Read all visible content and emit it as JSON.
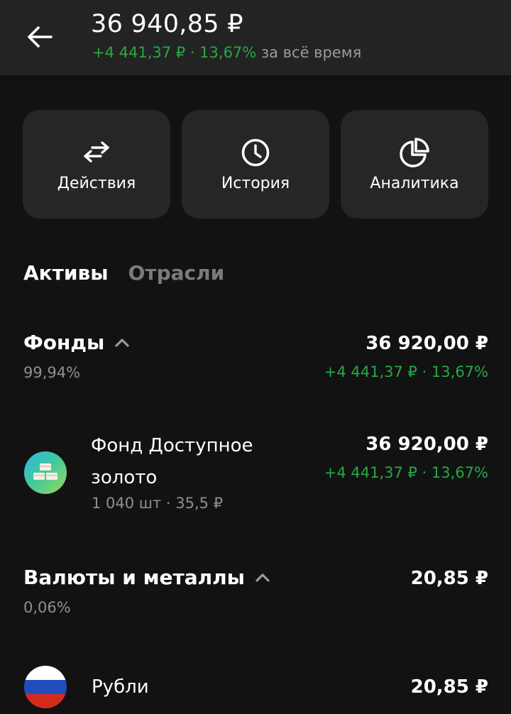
{
  "header": {
    "total": "36 940,85 ₽",
    "change": "+4 441,37 ₽ · 13,67%",
    "period": "за всё время"
  },
  "actions": [
    {
      "label": "Действия",
      "icon": "transfer-arrows-icon"
    },
    {
      "label": "История",
      "icon": "clock-icon"
    },
    {
      "label": "Аналитика",
      "icon": "pie-chart-icon"
    }
  ],
  "tabs": [
    {
      "label": "Активы",
      "active": true
    },
    {
      "label": "Отрасли",
      "active": false
    }
  ],
  "groups": [
    {
      "title": "Фонды",
      "share": "99,94%",
      "amount": "36 920,00 ₽",
      "change": "+4 441,37 ₽ · 13,67%",
      "items": [
        {
          "name": "Фонд Доступное золото",
          "quantity": "1 040 шт · 35,5 ₽",
          "amount": "36 920,00 ₽",
          "change": "+4 441,37 ₽ · 13,67%",
          "icon": "gold-bars-icon"
        }
      ]
    },
    {
      "title": "Валюты и металлы",
      "share": "0,06%",
      "amount": "20,85 ₽",
      "items": [
        {
          "name": "Рубли",
          "amount": "20,85 ₽",
          "icon": "russia-flag-icon"
        }
      ]
    }
  ],
  "colors": {
    "positive": "#27a844",
    "background": "#121212",
    "header": "#232323",
    "card": "#262626"
  }
}
